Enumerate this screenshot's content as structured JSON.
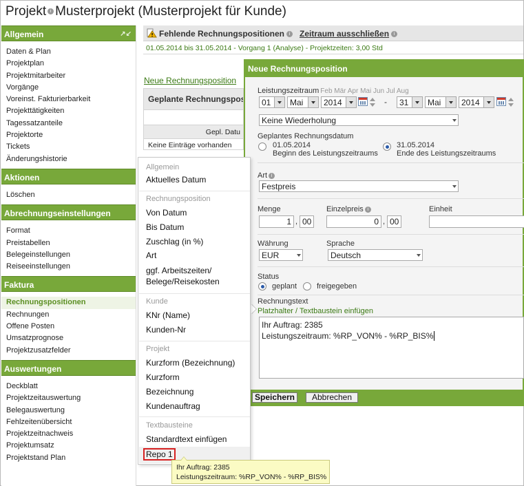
{
  "header": {
    "title_prefix": "Projekt",
    "title_main": "Musterprojekt (Musterprojekt für Kunde)"
  },
  "sidebar": {
    "sections": [
      {
        "title": "Allgemein",
        "items": [
          "Daten & Plan",
          "Projektplan",
          "Projektmitarbeiter",
          "Vorgänge",
          "Voreinst. Fakturierbarkeit",
          "Projekttätigkeiten",
          "Tagessatzanteile",
          "Projektorte",
          "Tickets",
          "Änderungshistorie"
        ]
      },
      {
        "title": "Aktionen",
        "items": [
          "Löschen"
        ]
      },
      {
        "title": "Abrechnungseinstellungen",
        "items": [
          "Format",
          "Preistabellen",
          "Belegeinstellungen",
          "Reiseeinstellungen"
        ]
      },
      {
        "title": "Faktura",
        "items": [
          "Rechnungspositionen",
          "Rechnungen",
          "Offene Posten",
          "Umsatzprognose",
          "Projektzusatzfelder"
        ],
        "active": "Rechnungspositionen"
      },
      {
        "title": "Auswertungen",
        "items": [
          "Deckblatt",
          "Projektzeitauswertung",
          "Belegauswertung",
          "Fehlzeitenübersicht",
          "Projektzeitnachweis",
          "Projektumsatz",
          "Projektstand Plan"
        ]
      }
    ]
  },
  "main": {
    "bar_title": "Fehlende Rechnungspositionen",
    "bar_link": "Zeitraum ausschließen",
    "status_line": "01.05.2014 bis 31.05.2014 - Vorgang 1 (Analyse) - Projektzeiten: 3,00 Std",
    "new_position_link": "Neue Rechnungsposition",
    "planned_table": {
      "title": "Geplante Rechnungsposi",
      "column": "Gepl. Datu",
      "empty": "Keine Einträge vorhanden"
    }
  },
  "dialog": {
    "title": "Neue Rechnungsposition",
    "period_label": "Leistungszeitraum",
    "month_shortcuts": "Feb Mär Apr Mai Jun Jul Aug",
    "from": {
      "day": "01",
      "month": "Mai",
      "year": "2014"
    },
    "dash": "-",
    "to": {
      "day": "31",
      "month": "Mai",
      "year": "2014"
    },
    "repeat": "Keine Wiederholung",
    "planned_date_label": "Geplantes Rechnungsdatum",
    "date_option1": {
      "date": "01.05.2014",
      "desc": "Beginn des Leistungszeitraums"
    },
    "date_option2": {
      "date": "31.05.2014",
      "desc": "Ende des Leistungszeitraums"
    },
    "type_label": "Art",
    "type_value": "Festpreis",
    "qty_label": "Menge",
    "qty_int": "1",
    "qty_dec": "00",
    "unit_price_label": "Einzelpreis",
    "price_int": "0",
    "price_dec": "00",
    "decimal_sep": ",",
    "unit_label": "Einheit",
    "currency_label": "Währung",
    "currency_value": "EUR",
    "language_label": "Sprache",
    "language_value": "Deutsch",
    "status_label": "Status",
    "status_planned": "geplant",
    "status_released": "freigegeben",
    "invoice_text_label": "Rechnungstext",
    "placeholder_link": "Platzhalter / Textbaustein einfügen",
    "invoice_text_line1": "Ihr Auftrag: 2385",
    "invoice_text_line2": "Leistungszeitraum: %RP_VON% - %RP_BIS%",
    "save_label": "Speichern",
    "cancel_label": "Abbrechen"
  },
  "menu": {
    "group_allgemein": "Allgemein",
    "aktuelles_datum": "Aktuelles Datum",
    "group_position": "Rechnungsposition",
    "von_datum": "Von Datum",
    "bis_datum": "Bis Datum",
    "zuschlag": "Zuschlag (in %)",
    "art": "Art",
    "arbeitszeiten_1": "ggf. Arbeitszeiten/",
    "arbeitszeiten_2": "Belege/Reisekosten",
    "group_kunde": "Kunde",
    "knr": "KNr (Name)",
    "kunden_nr": "Kunden-Nr",
    "group_projekt": "Projekt",
    "kurzform_bez": "Kurzform (Bezeichnung)",
    "kurzform": "Kurzform",
    "bezeichnung": "Bezeichnung",
    "kundenauftrag": "Kundenauftrag",
    "group_textbausteine": "Textbausteine",
    "standardtext": "Standardtext einfügen",
    "repo1": "Repo 1"
  },
  "tooltip": {
    "line1": "Ihr Auftrag: 2385",
    "line2": "Leistungszeitraum: %RP_VON% - %RP_BIS%"
  },
  "colors": {
    "accent_green": "#78a83a",
    "link_green": "#3b7a14",
    "highlight_red": "#d62020",
    "tooltip_bg": "#fbfbc4"
  }
}
